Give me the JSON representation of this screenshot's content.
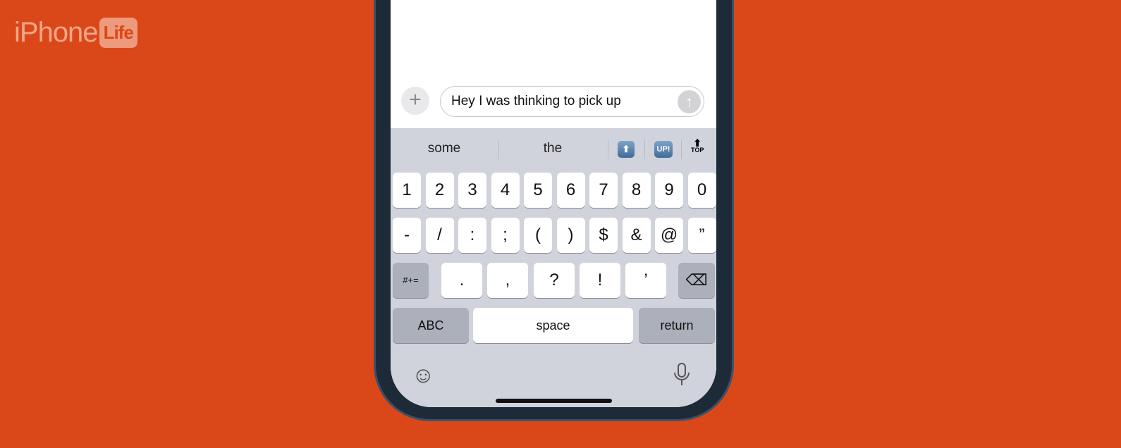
{
  "logo": {
    "text": "iPhone",
    "badge": "Life"
  },
  "compose": {
    "plus_icon": "plus-icon",
    "text": "Hey I was thinking to pick up",
    "send_icon": "arrow-up-icon"
  },
  "suggestions": {
    "items": [
      "some",
      "the"
    ],
    "emoji": [
      "⬆",
      "UP!",
      "TOP"
    ]
  },
  "keyboard": {
    "row1": [
      "1",
      "2",
      "3",
      "4",
      "5",
      "6",
      "7",
      "8",
      "9",
      "0"
    ],
    "row2": [
      "-",
      "/",
      ":",
      ";",
      "(",
      ")",
      "$",
      "&",
      "@",
      "”"
    ],
    "row3": {
      "symbols": "#+=",
      "keys": [
        ".",
        ",",
        "?",
        "!",
        "’"
      ],
      "delete_icon": "backspace-icon"
    },
    "row4": {
      "abc": "ABC",
      "space": "space",
      "return": "return"
    },
    "emoji_icon": "smiley-icon",
    "mic_icon": "microphone-icon"
  },
  "colors": {
    "background": "#DA4819",
    "keyboard": "#D0D3DB"
  }
}
